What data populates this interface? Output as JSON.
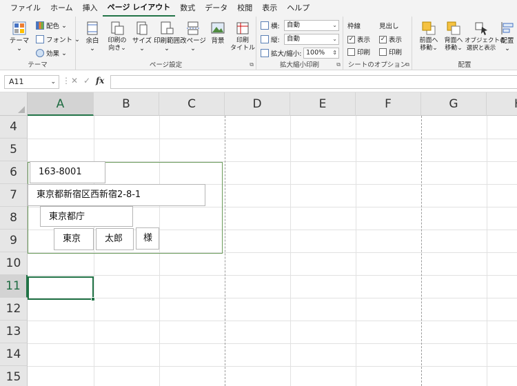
{
  "menu": {
    "tabs": [
      "ファイル",
      "ホーム",
      "挿入",
      "ページ レイアウト",
      "数式",
      "データ",
      "校閲",
      "表示",
      "ヘルプ"
    ],
    "active_tab": "ページ レイアウト"
  },
  "ribbon": {
    "theme_group": {
      "label": "テーマ",
      "themes_button": "テーマ",
      "colors": "配色",
      "fonts": "フォント",
      "effects": "効果"
    },
    "page_setup_group": {
      "label": "ページ設定",
      "margins": "余白",
      "orientation": "印刷の向き",
      "size": "サイズ",
      "print_area": "印刷範囲",
      "breaks": "改ページ",
      "background": "背景",
      "print_titles": "印刷タイトル"
    },
    "scale_group": {
      "label": "拡大縮小印刷",
      "width_label": "横:",
      "width_value": "自動",
      "height_label": "縦:",
      "height_value": "自動",
      "scale_label": "拡大/縮小:",
      "scale_value": "100%"
    },
    "sheet_options_group": {
      "label": "シートのオプション",
      "gridlines": "枠線",
      "headings": "見出し",
      "view": "表示",
      "print": "印刷"
    },
    "arrange_group": {
      "label": "配置",
      "bring_forward": "前面へ移動",
      "send_backward": "背面へ移動",
      "selection_pane": "オブジェクトの選択と表示",
      "align": "配置"
    }
  },
  "formula_bar": {
    "name_box": "A11",
    "fx": "fx",
    "content": ""
  },
  "columns": [
    "A",
    "B",
    "C",
    "D",
    "E",
    "F",
    "G",
    "H"
  ],
  "selected_column": "A",
  "rows": [
    "4",
    "5",
    "6",
    "7",
    "8",
    "9",
    "10",
    "11",
    "12",
    "13",
    "14",
    "15"
  ],
  "selected_row": "11",
  "textboxes": {
    "postal_code": "163-8001",
    "address": "東京都新宿区西新宿2-8-1",
    "organization": "東京都庁",
    "last_name": "東京",
    "first_name": "太郎",
    "honorific": "様"
  }
}
